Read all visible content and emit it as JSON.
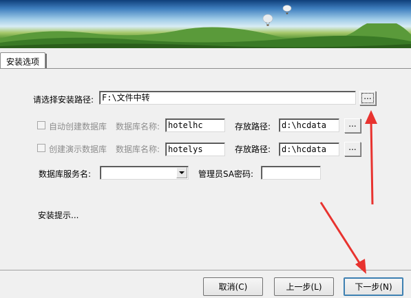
{
  "tab": {
    "label": "安装选项"
  },
  "install": {
    "path_label": "请选择安装路径:",
    "path_value": "F:\\文件中转",
    "browse_label": "..."
  },
  "db_auto": {
    "checkbox_label": "自动创建数据库",
    "name_label": "数据库名称:",
    "name_value": "hotelhc",
    "store_label": "存放路径:",
    "store_value": "d:\\hcdata",
    "browse_label": "..."
  },
  "db_demo": {
    "checkbox_label": "创建演示数据库",
    "name_label": "数据库名称:",
    "name_value": "hotelys",
    "store_label": "存放路径:",
    "store_value": "d:\\hcdata",
    "browse_label": "..."
  },
  "server": {
    "service_label": "数据库服务名:",
    "service_value": "",
    "sa_label": "管理员SA密码:",
    "sa_value": ""
  },
  "hint": "安装提示...",
  "buttons": {
    "cancel": "取消(C)",
    "back": "上一步(L)",
    "next": "下一步(N)"
  },
  "colors": {
    "annotation_arrow": "#e8332f"
  }
}
